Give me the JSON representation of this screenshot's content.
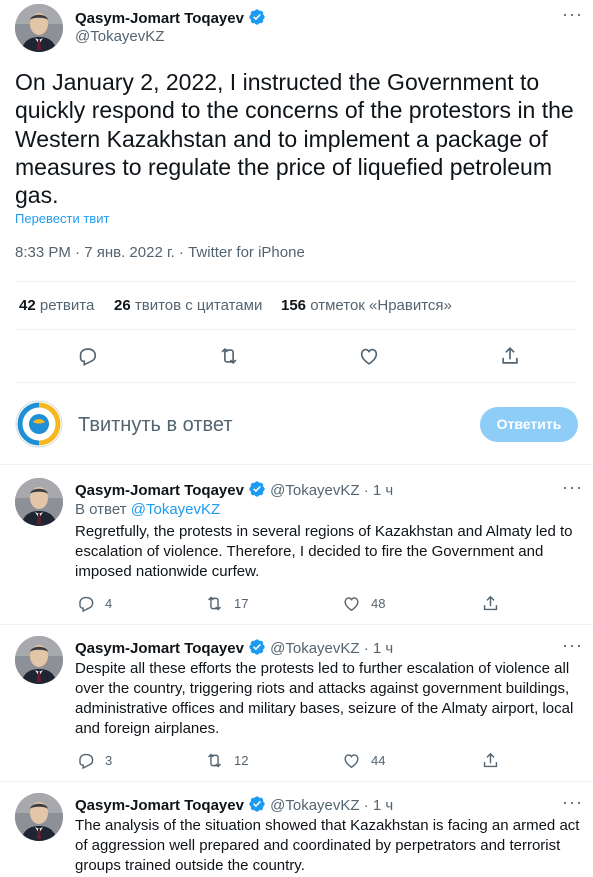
{
  "main_tweet": {
    "author_name": "Qasym-Jomart Toqayev",
    "author_handle": "@TokayevKZ",
    "text": "On January 2, 2022, I instructed the Government to quickly respond to the concerns of the protestors in the Western Kazakhstan and to implement a package of measures to regulate the price of liquefied petroleum gas.",
    "translate_link": "Перевести твит",
    "meta": "8:33 PM · 7 янв. 2022 г. · Twitter for iPhone",
    "stats": {
      "retweets_count": "42",
      "retweets_label": "ретвита",
      "quotes_count": "26",
      "quotes_label": "твитов с цитатами",
      "likes_count": "156",
      "likes_label": "отметок «Нравится»"
    }
  },
  "reply_box": {
    "placeholder": "Твитнуть в ответ",
    "button_label": "Ответить"
  },
  "replies": [
    {
      "author_name": "Qasym-Jomart Toqayev",
      "author_handle": "@TokayevKZ",
      "time": "· 1 ч",
      "reply_prefix": "В ответ",
      "reply_to": "@TokayevKZ",
      "text": "Regretfully, the protests in several regions of Kazakhstan and Almaty led to escalation of violence. Therefore, I decided to fire the Government and imposed nationwide curfew.",
      "replies_count": "4",
      "retweets_count": "17",
      "likes_count": "48"
    },
    {
      "author_name": "Qasym-Jomart Toqayev",
      "author_handle": "@TokayevKZ",
      "time": "· 1 ч",
      "text": "Despite all these efforts the protests led to further escalation of violence all over the country, triggering riots and attacks against government buildings, administrative offices and military bases, seizure of the Almaty airport, local and foreign airplanes.",
      "replies_count": "3",
      "retweets_count": "12",
      "likes_count": "44"
    },
    {
      "author_name": "Qasym-Jomart Toqayev",
      "author_handle": "@TokayevKZ",
      "time": "· 1 ч",
      "text": "The analysis of the situation showed that Kazakhstan is facing an armed act of aggression well prepared and coordinated by perpetrators and terrorist groups trained outside the country."
    }
  ],
  "colors": {
    "accent": "#1d9bf0",
    "button_disabled": "#8ecdf8",
    "text_primary": "#0f1419",
    "text_secondary": "#536471",
    "divider": "#eff3f4"
  },
  "icons": [
    "verified-badge-icon",
    "more-icon",
    "reply-icon",
    "retweet-icon",
    "like-icon",
    "share-icon"
  ]
}
